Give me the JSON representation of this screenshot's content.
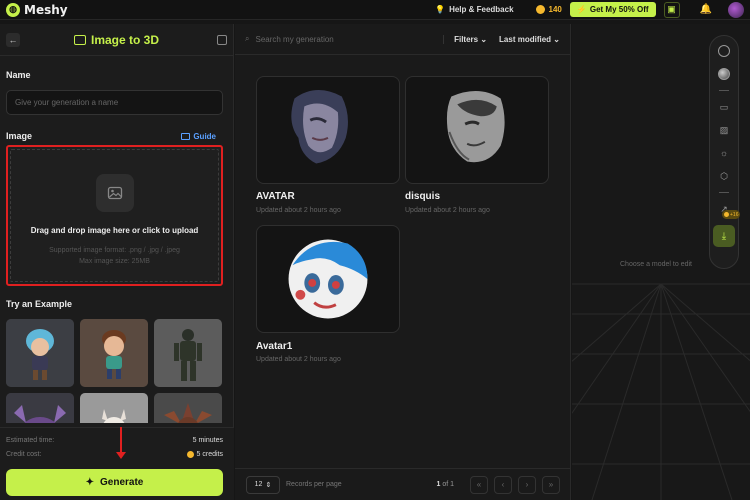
{
  "topbar": {
    "logo_text": "Meshy",
    "help_label": "Help & Feedback",
    "credits": "140",
    "promo_label": "Get My 50% Off"
  },
  "left": {
    "title": "Image to 3D",
    "name_label": "Name",
    "name_placeholder": "Give your generation a name",
    "image_label": "Image",
    "guide_label": "Guide",
    "upload_main": "Drag and drop image here or click to upload",
    "upload_formats": "Supported image format: .png / .jpg / .jpeg",
    "upload_max": "Max image size: 25MB",
    "examples_label": "Try an Example",
    "estimated_time_label": "Estimated time:",
    "estimated_time_value": "5 minutes",
    "credit_cost_label": "Credit cost:",
    "credit_cost_value": "5 credits",
    "generate_label": "Generate"
  },
  "gallery": {
    "search_placeholder": "Search my generation",
    "filters_label": "Filters",
    "sort_label": "Last modified",
    "items": [
      {
        "title": "AVATAR",
        "subtitle": "Updated about 2 hours ago"
      },
      {
        "title": "disquis",
        "subtitle": "Updated about 2 hours ago"
      },
      {
        "title": "Avatar1",
        "subtitle": "Updated about 2 hours ago"
      }
    ],
    "per_page": "12",
    "per_page_label": "Records per page",
    "page_current": "1",
    "page_of": "of 1"
  },
  "viewport": {
    "hint": "Choose a model to edit",
    "badge": "+16"
  },
  "colors": {
    "accent": "#c5f04a",
    "highlight": "#e02020",
    "link": "#5aa0ff",
    "coin": "#f5b82e"
  }
}
